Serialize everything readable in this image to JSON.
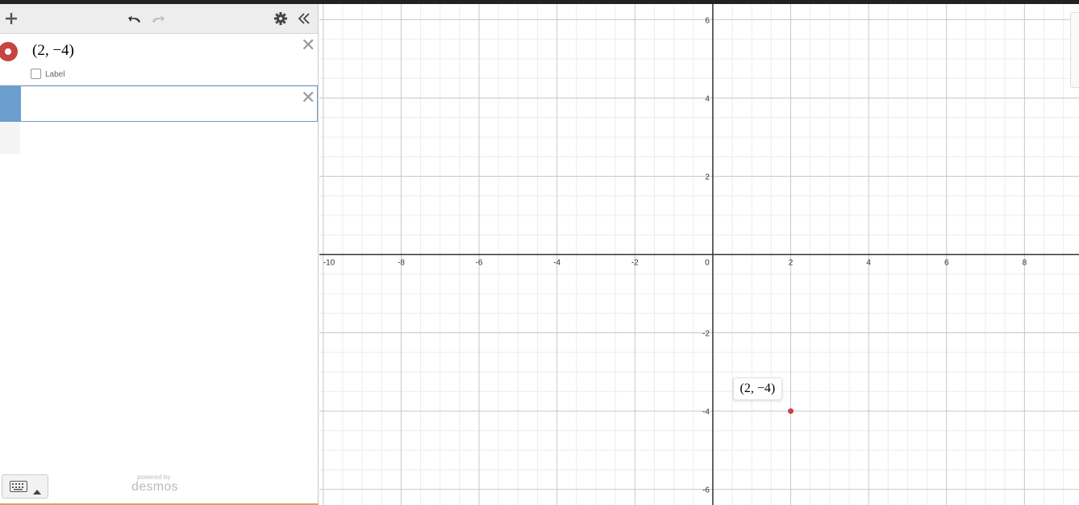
{
  "toolbar": {
    "add_icon": "plus-icon",
    "undo_icon": "undo-icon",
    "redo_icon": "redo-icon",
    "settings_icon": "gear-icon",
    "collapse_icon": "double-chevron-left-icon"
  },
  "expressions": [
    {
      "color": "#c74440",
      "latex_text": "(2, −4)",
      "label_checkbox": "Label",
      "checked": false
    },
    {
      "value": "",
      "active": true
    }
  ],
  "keypad": {
    "icon": "keyboard-icon"
  },
  "branding": {
    "powered_by": "powered by",
    "name": "desmos"
  },
  "graph": {
    "x_ticks": [
      "-10",
      "-8",
      "-6",
      "-4",
      "-2",
      "0",
      "2",
      "4",
      "6",
      "8"
    ],
    "y_ticks": [
      "6",
      "4",
      "2",
      "-2",
      "-4",
      "-6"
    ],
    "point": {
      "x": 2,
      "y": -4,
      "label": "(2, −4)",
      "color": "#c74440"
    },
    "x_range": [
      -10.1,
      9.4
    ],
    "y_range": [
      -6.4,
      6.4
    ]
  }
}
